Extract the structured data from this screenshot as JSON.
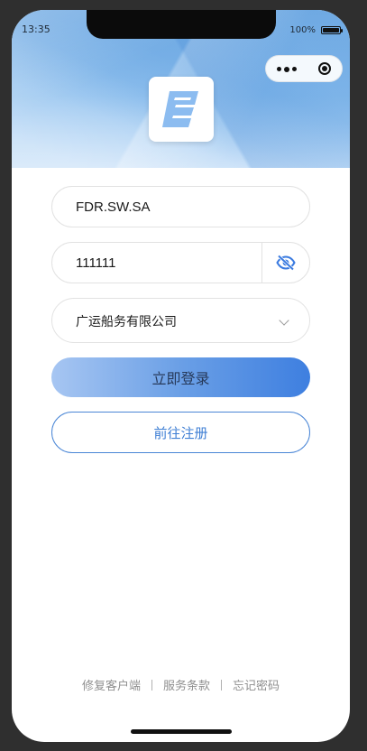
{
  "status_bar": {
    "time": "13:35",
    "battery": "100%"
  },
  "form": {
    "username": "FDR.SW.SA",
    "password": "111111",
    "company": "广运船务有限公司"
  },
  "buttons": {
    "login": "立即登录",
    "register": "前往注册"
  },
  "footer": {
    "repair": "修复客户端",
    "terms": "服务条款",
    "forgot": "忘记密码"
  },
  "colors": {
    "accent": "#3f7fd4",
    "header_blue": "#94c3ef"
  },
  "icons": {
    "logo": "letter-e-logo",
    "password_toggle": "eye-slash-icon",
    "company_dropdown": "chevron-down-icon"
  }
}
